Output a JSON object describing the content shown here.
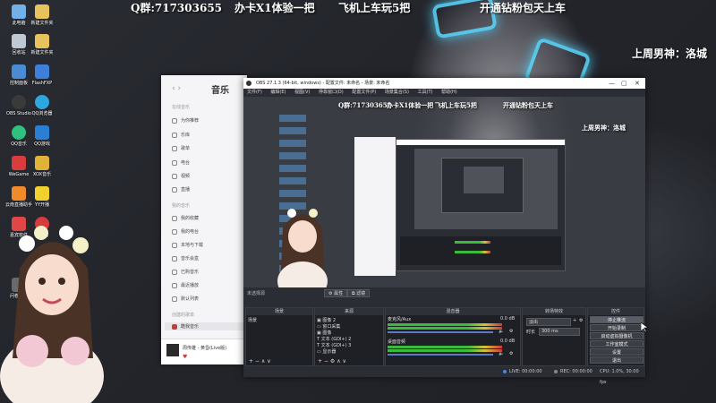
{
  "overlay": {
    "qq_group": "Q群:717303655",
    "line2": "办卡X1体验一把",
    "line3": "飞机上车玩5把",
    "line4": "开通钻粉包天上车",
    "side_note": "上周男神：洛城"
  },
  "desktop_icons": [
    {
      "label": "此电脑",
      "color": "#6fb1e8"
    },
    {
      "label": "新建文件夹",
      "color": "#e8c25a"
    },
    {
      "label": "回收站",
      "color": "#bfc9d4"
    },
    {
      "label": "新建文件夹",
      "color": "#e8c25a"
    },
    {
      "label": "控制面板",
      "color": "#4a8bd6"
    },
    {
      "label": "FlashFXP",
      "color": "#3d7fd9"
    },
    {
      "label": "OBS Studio",
      "color": "#3a3a3a"
    },
    {
      "label": "QQ浏览器",
      "color": "#2ea7e0"
    },
    {
      "label": "QQ音乐",
      "color": "#2ec27e"
    },
    {
      "label": "QQ游戏",
      "color": "#2a7fd4"
    },
    {
      "label": "WeGame",
      "color": "#d93c3c"
    },
    {
      "label": "XOX音乐",
      "color": "#e0b23a"
    },
    {
      "label": "云南直播助手",
      "color": "#f08a2a"
    },
    {
      "label": "YY开播",
      "color": "#f2d12e"
    },
    {
      "label": "嘉宾软件",
      "color": "#e04646"
    },
    {
      "label": "网易云",
      "color": "#d73b3b"
    },
    {
      "label": "问卷设置",
      "color": "#6a6a6a"
    }
  ],
  "music_app": {
    "title": "音乐",
    "nav": "‹  ›",
    "sections": {
      "online": "在线音乐",
      "mine": "我的音乐",
      "playlists": "创建的歌单"
    },
    "items_online": [
      "为你推荐",
      "乐库",
      "歌单",
      "电台",
      "视频",
      "直播"
    ],
    "items_mine": [
      "我的收藏",
      "我的电台",
      "本地与下载",
      "音乐会盒",
      "已购音乐",
      "最近播放",
      "默认列表"
    ],
    "playlist_active": "酷我音乐",
    "now_playing": "周传雄 - 黄昏(Live版)"
  },
  "obs": {
    "window_title": "OBS 27.1.3 (64-bit, windows) - 配置文件: 未命名 - 场景: 未命名",
    "menu": [
      "文件(F)",
      "编辑(E)",
      "视图(V)",
      "停靠窗口(D)",
      "配置文件(P)",
      "场景集合(S)",
      "工具(T)",
      "帮助(H)"
    ],
    "source_label": "未选择源",
    "btn_properties": "属性",
    "btn_filters": "滤镜",
    "panes": {
      "scenes": "场景",
      "sources": "来源",
      "mixer": "混音器",
      "transitions": "转场特效",
      "controls": "控件"
    },
    "scene_items": [
      "场景"
    ],
    "source_items": [
      "图像 2",
      "窗口采集",
      "图像",
      "文本 (GDI+) 2",
      "文本 (GDI+) 3",
      "显示器"
    ],
    "mixer": [
      {
        "name": "麦克风/Aux",
        "db": "0.0 dB"
      },
      {
        "name": "桌面音频",
        "db": "0.0 dB"
      }
    ],
    "transition": "淡出",
    "duration_label": "时长",
    "duration_value": "300 ms",
    "controls": [
      "停止推流",
      "开始录制",
      "启动虚拟摄像机",
      "工作室模式",
      "设置",
      "退出"
    ],
    "status": {
      "live": "LIVE: 00:00:00",
      "rec": "REC: 00:00:00",
      "cpu": "CPU: 1.0%, 30.00 fps"
    }
  }
}
